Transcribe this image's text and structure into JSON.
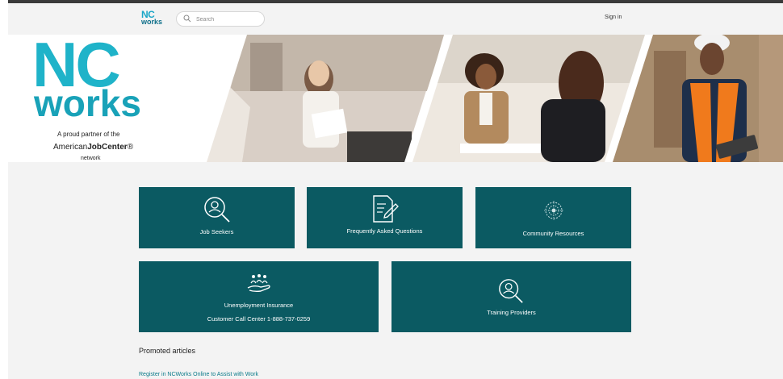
{
  "header": {
    "logo_nc": "NC",
    "logo_works": "works",
    "search_placeholder": "Search",
    "sign_in": "Sign in"
  },
  "hero": {
    "brand_nc": "NC",
    "brand_works": "works",
    "partner_text": "A proud partner of the",
    "ajc_prefix": "American",
    "ajc_bold": "JobCenter",
    "ajc_suffix": "®",
    "network_text": "network"
  },
  "tiles": [
    {
      "label": "Job Seekers",
      "icon": "search-user-icon"
    },
    {
      "label": "Frequently Asked Questions",
      "icon": "document-edit-icon"
    },
    {
      "label": "Community Resources",
      "icon": "community-icon"
    },
    {
      "label": "Unemployment Insurance",
      "sub": "Customer Call Center 1-888-737-0259",
      "icon": "hand-people-icon"
    },
    {
      "label": "Training Providers",
      "icon": "search-user-icon"
    }
  ],
  "promoted": {
    "heading": "Promoted articles",
    "articles": [
      "Register in NCWorks Online to Assist with Work"
    ]
  },
  "colors": {
    "tile": "#0b5a62",
    "brand_teal": "#1fb3c9",
    "brand_green": "#8cc63f",
    "link": "#0b7b8a"
  }
}
